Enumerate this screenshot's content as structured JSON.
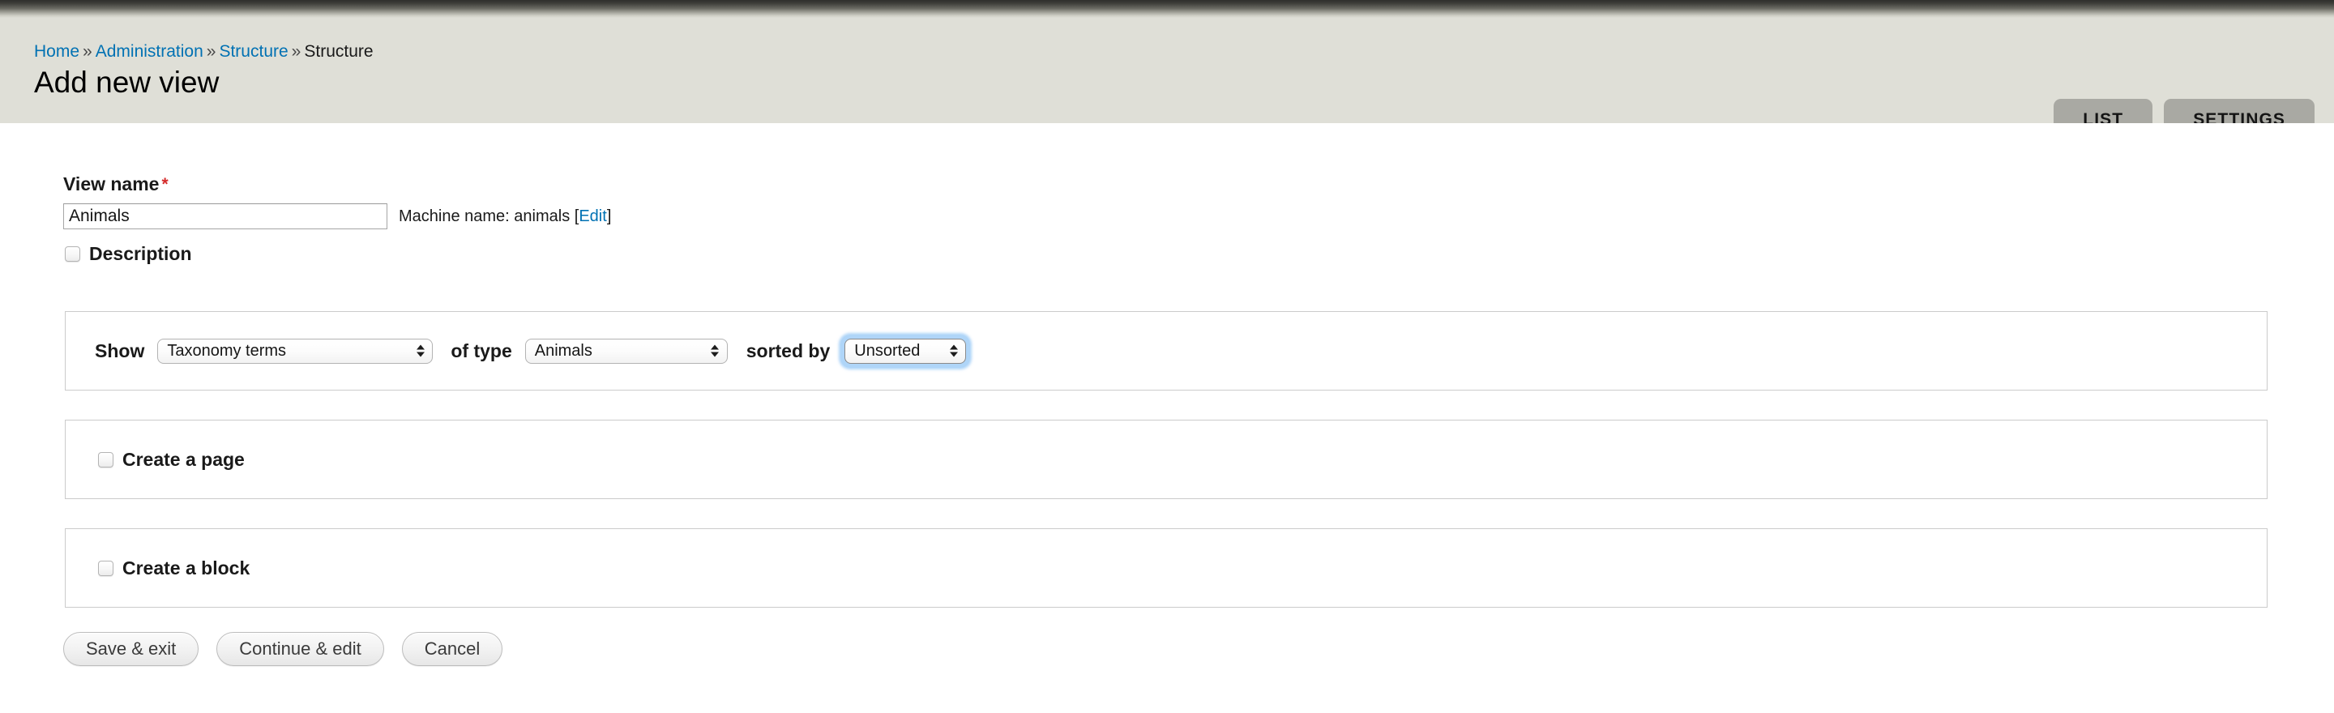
{
  "header": {
    "breadcrumb": [
      {
        "label": "Home",
        "link": true
      },
      {
        "label": "Administration",
        "link": true
      },
      {
        "label": "Structure",
        "link": true
      },
      {
        "label": "Structure",
        "link": false
      }
    ],
    "separator": "»",
    "title": "Add new view",
    "tabs": [
      {
        "label": "LIST",
        "active": true
      },
      {
        "label": "SETTINGS",
        "active": false
      }
    ]
  },
  "form": {
    "view_name": {
      "label": "View name",
      "required_mark": "*",
      "value": "Animals",
      "placeholder": ""
    },
    "machine_name": {
      "prefix": "Machine name: animals",
      "bracket_open": "[",
      "edit_label": "Edit",
      "bracket_close": "]"
    },
    "description": {
      "label": "Description",
      "checked": false
    },
    "show_row": {
      "show_label": "Show",
      "show_value": "Taxonomy terms",
      "of_type_label": "of type",
      "of_type_value": "Animals",
      "sorted_by_label": "sorted by",
      "sorted_by_value": "Unsorted"
    },
    "create_page": {
      "label": "Create a page",
      "checked": false
    },
    "create_block": {
      "label": "Create a block",
      "checked": false
    },
    "buttons": [
      {
        "label": "Save & exit"
      },
      {
        "label": "Continue & edit"
      },
      {
        "label": "Cancel"
      }
    ]
  },
  "colors": {
    "header_bg": "#dfdfd7",
    "link": "#0071b3",
    "required": "#d42a2a",
    "tab_bg": "#a9a9a3",
    "focus_ring": "#6db3f2",
    "panel_border": "#cbcbcb"
  }
}
